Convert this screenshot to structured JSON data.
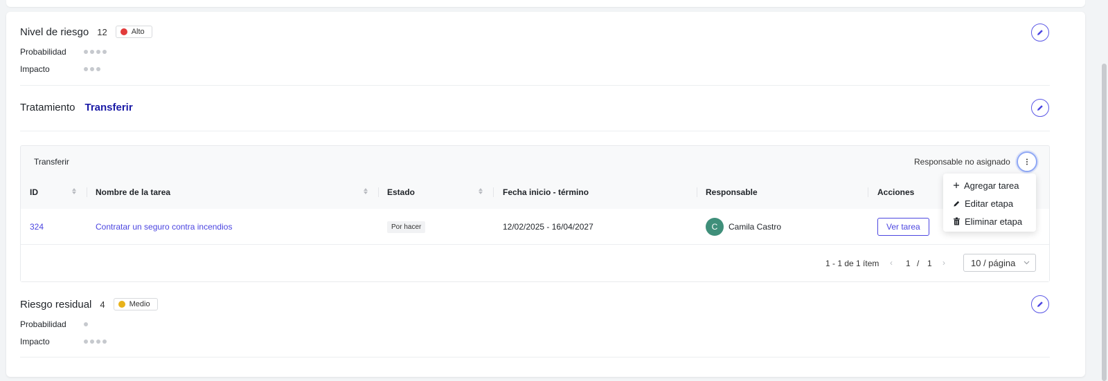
{
  "risk_level": {
    "title": "Nivel de riesgo",
    "score": "12",
    "badge": {
      "label": "Alto",
      "color": "#e23b3b"
    },
    "probability_label": "Probabilidad",
    "probability_value": 4,
    "impact_label": "Impacto",
    "impact_value": 3
  },
  "treatment": {
    "title": "Tratamiento",
    "value": "Transferir",
    "value_color": "#1a1aa6"
  },
  "stage": {
    "name": "Transferir",
    "responsible_status": "Responsable no asignado",
    "columns": {
      "id": "ID",
      "task_name": "Nombre de la tarea",
      "status": "Estado",
      "dates": "Fecha inicio - término",
      "responsible": "Responsable",
      "actions": "Acciones"
    },
    "rows": [
      {
        "id": "324",
        "task_name": "Contratar un seguro contra incendios",
        "status": "Por hacer",
        "dates": "12/02/2025 - 16/04/2027",
        "avatar_initial": "C",
        "responsible": "Camila Castro",
        "action_label": "Ver tarea"
      }
    ],
    "pagination": {
      "summary": "1 - 1 de 1 ítem",
      "current": "1",
      "separator": "/",
      "total": "1",
      "page_size": "10 / página"
    }
  },
  "menu": {
    "items": [
      {
        "label": "Agregar tarea",
        "icon": "plus-icon"
      },
      {
        "label": "Editar etapa",
        "icon": "pencil-icon"
      },
      {
        "label": "Eliminar etapa",
        "icon": "trash-icon"
      }
    ]
  },
  "residual_risk": {
    "title": "Riesgo residual",
    "score": "4",
    "badge": {
      "label": "Medio",
      "color": "#e8b21a"
    },
    "probability_label": "Probabilidad",
    "probability_value": 1,
    "impact_label": "Impacto",
    "impact_value": 4
  },
  "colors": {
    "accent": "#4b45e0",
    "link": "#4b45e0",
    "avatar": "#3f8f7a"
  }
}
